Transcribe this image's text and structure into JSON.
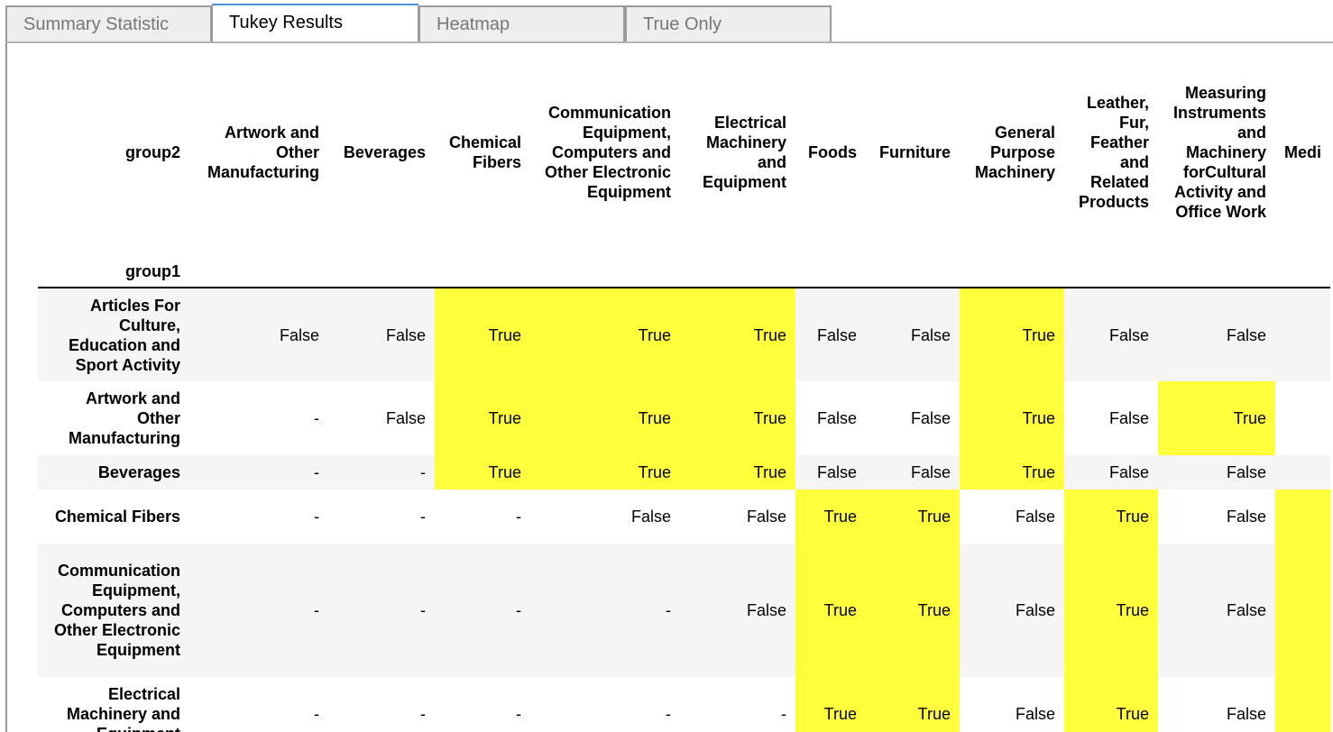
{
  "tabs": [
    {
      "label": "Summary Statistic",
      "active": false
    },
    {
      "label": "Tukey Results",
      "active": true
    },
    {
      "label": "Heatmap",
      "active": false
    },
    {
      "label": "True Only",
      "active": false
    }
  ],
  "table": {
    "columns_axis_label": "group2",
    "index_axis_label": "group1",
    "columns": [
      "Artwork and Other Manufacturing",
      "Beverages",
      "Chemical Fibers",
      "Communication Equipment, Computers and Other Electronic Equipment",
      "Electrical Machinery and Equipment",
      "Foods",
      "Furniture",
      "General Purpose Machinery",
      "Leather, Fur, Feather and Related Products",
      "Measuring Instruments and Machinery forCultural Activity and Office Work",
      "Medi"
    ],
    "rows": [
      {
        "label": "Articles For Culture, Education and Sport Activity",
        "cells": [
          "False",
          "False",
          "True",
          "True",
          "True",
          "False",
          "False",
          "True",
          "False",
          "False",
          ""
        ]
      },
      {
        "label": "Artwork and Other Manufacturing",
        "cells": [
          "-",
          "False",
          "True",
          "True",
          "True",
          "False",
          "False",
          "True",
          "False",
          "True",
          ""
        ]
      },
      {
        "label": "Beverages",
        "cells": [
          "-",
          "-",
          "True",
          "True",
          "True",
          "False",
          "False",
          "True",
          "False",
          "False",
          ""
        ]
      },
      {
        "label": "Chemical Fibers",
        "cells": [
          "-",
          "-",
          "-",
          "False",
          "False",
          "True",
          "True",
          "False",
          "True",
          "False",
          ""
        ]
      },
      {
        "label": "Communication Equipment, Computers and Other Electronic Equipment",
        "cells": [
          "-",
          "-",
          "-",
          "-",
          "False",
          "True",
          "True",
          "False",
          "True",
          "False",
          ""
        ]
      },
      {
        "label": "Electrical Machinery and Equipment",
        "cells": [
          "-",
          "-",
          "-",
          "-",
          "-",
          "True",
          "True",
          "False",
          "True",
          "False",
          ""
        ]
      }
    ],
    "highlight_color": "#ffff3b",
    "last_column_highlight": [
      false,
      false,
      false,
      true,
      true,
      true
    ]
  }
}
